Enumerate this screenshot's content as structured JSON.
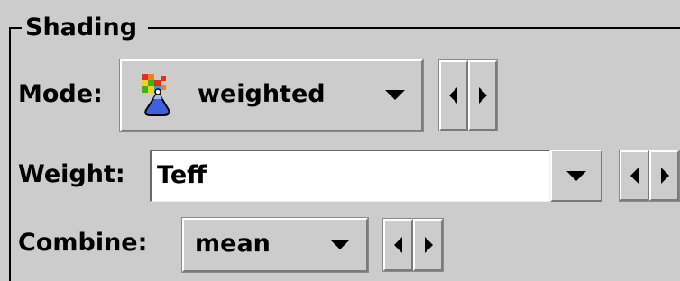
{
  "panel": {
    "title": "Shading"
  },
  "mode": {
    "label": "Mode:",
    "value": "weighted",
    "icon": "weighted-shading-icon"
  },
  "weight": {
    "label": "Weight:",
    "value": "Teff"
  },
  "combine": {
    "label": "Combine:",
    "value": "mean"
  },
  "colors": {
    "background": "#cccccc",
    "field_background": "#ffffff",
    "text": "#000000"
  }
}
